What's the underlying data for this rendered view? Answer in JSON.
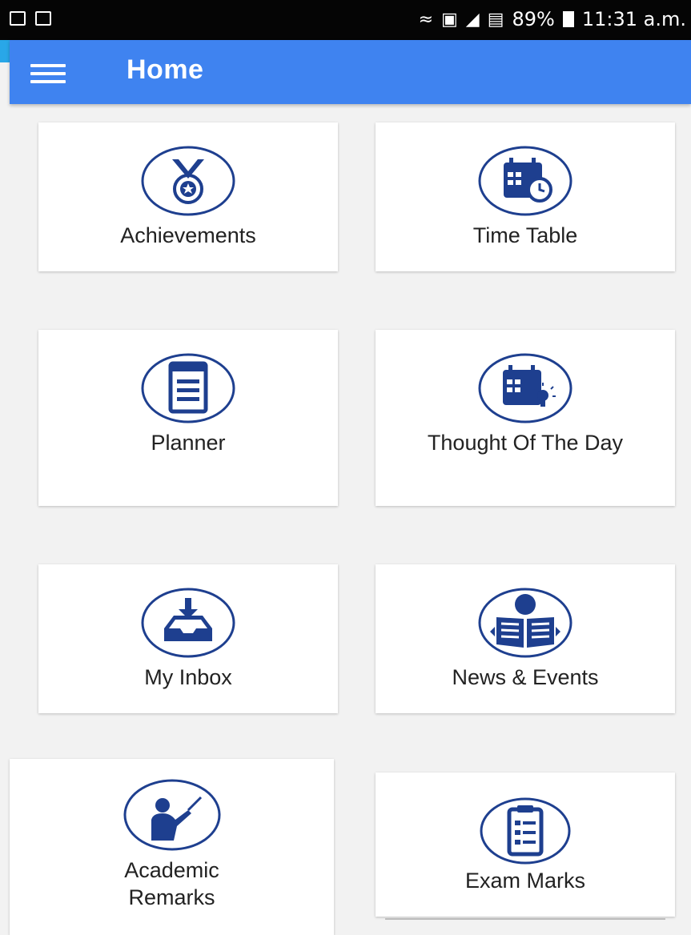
{
  "status_bar": {
    "battery_percent": "89%",
    "time": "11:31 a.m."
  },
  "app_bar": {
    "title": "Home"
  },
  "tiles": [
    {
      "label": "Achievements",
      "icon": "medal-icon"
    },
    {
      "label": "Time Table",
      "icon": "calendar-clock-icon"
    },
    {
      "label": "Planner",
      "icon": "planner-document-icon"
    },
    {
      "label": "Thought Of The Day",
      "icon": "calendar-lightbulb-icon"
    },
    {
      "label": "My Inbox",
      "icon": "inbox-download-icon"
    },
    {
      "label": "News & Events",
      "icon": "news-reader-icon"
    },
    {
      "label": "Academic Remarks",
      "icon": "teacher-pointer-icon"
    },
    {
      "label": "Exam Marks",
      "icon": "exam-clipboard-icon"
    }
  ],
  "colors": {
    "app_bar": "#3f83f0",
    "icon_blue": "#1e3f8f",
    "background": "#f2f2f2"
  }
}
